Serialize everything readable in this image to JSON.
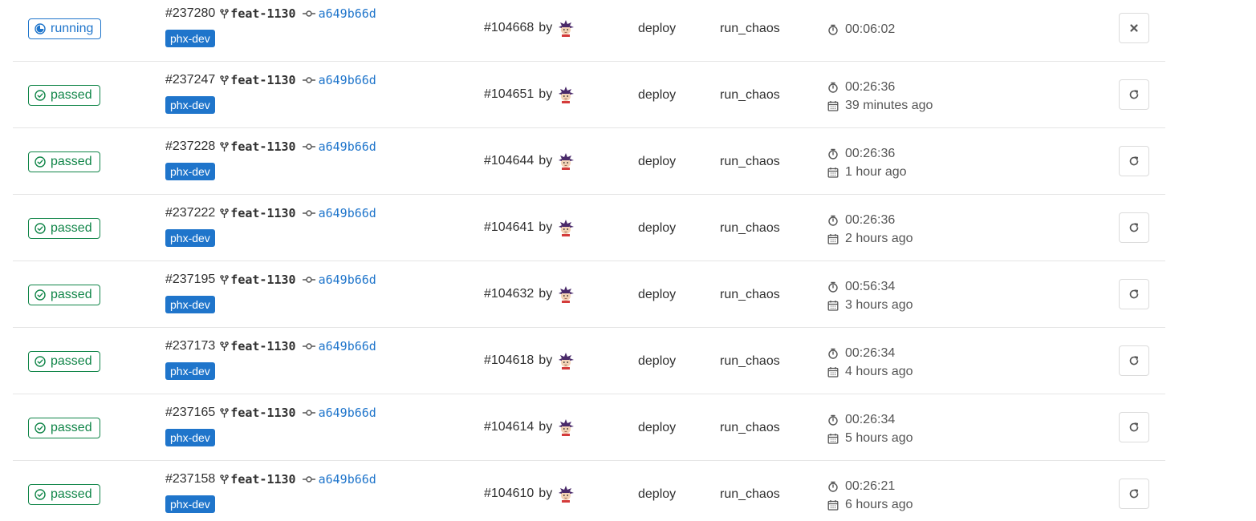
{
  "jobs": [
    {
      "status": "running",
      "job_id": "#237280",
      "branch": "feat-1130",
      "commit": "a649b66d",
      "env": "phx-dev",
      "pipeline": "#104668",
      "by": "by",
      "stage": "deploy",
      "name": "run_chaos",
      "duration": "00:06:02",
      "finished": null,
      "action": "cancel"
    },
    {
      "status": "passed",
      "job_id": "#237247",
      "branch": "feat-1130",
      "commit": "a649b66d",
      "env": "phx-dev",
      "pipeline": "#104651",
      "by": "by",
      "stage": "deploy",
      "name": "run_chaos",
      "duration": "00:26:36",
      "finished": "39 minutes ago",
      "action": "retry"
    },
    {
      "status": "passed",
      "job_id": "#237228",
      "branch": "feat-1130",
      "commit": "a649b66d",
      "env": "phx-dev",
      "pipeline": "#104644",
      "by": "by",
      "stage": "deploy",
      "name": "run_chaos",
      "duration": "00:26:36",
      "finished": "1 hour ago",
      "action": "retry"
    },
    {
      "status": "passed",
      "job_id": "#237222",
      "branch": "feat-1130",
      "commit": "a649b66d",
      "env": "phx-dev",
      "pipeline": "#104641",
      "by": "by",
      "stage": "deploy",
      "name": "run_chaos",
      "duration": "00:26:36",
      "finished": "2 hours ago",
      "action": "retry"
    },
    {
      "status": "passed",
      "job_id": "#237195",
      "branch": "feat-1130",
      "commit": "a649b66d",
      "env": "phx-dev",
      "pipeline": "#104632",
      "by": "by",
      "stage": "deploy",
      "name": "run_chaos",
      "duration": "00:56:34",
      "finished": "3 hours ago",
      "action": "retry"
    },
    {
      "status": "passed",
      "job_id": "#237173",
      "branch": "feat-1130",
      "commit": "a649b66d",
      "env": "phx-dev",
      "pipeline": "#104618",
      "by": "by",
      "stage": "deploy",
      "name": "run_chaos",
      "duration": "00:26:34",
      "finished": "4 hours ago",
      "action": "retry"
    },
    {
      "status": "passed",
      "job_id": "#237165",
      "branch": "feat-1130",
      "commit": "a649b66d",
      "env": "phx-dev",
      "pipeline": "#104614",
      "by": "by",
      "stage": "deploy",
      "name": "run_chaos",
      "duration": "00:26:34",
      "finished": "5 hours ago",
      "action": "retry"
    },
    {
      "status": "passed",
      "job_id": "#237158",
      "branch": "feat-1130",
      "commit": "a649b66d",
      "env": "phx-dev",
      "pipeline": "#104610",
      "by": "by",
      "stage": "deploy",
      "name": "run_chaos",
      "duration": "00:26:21",
      "finished": "6 hours ago",
      "action": "retry"
    }
  ],
  "icons": {
    "passed": "status-success-icon",
    "running": "status-running-icon",
    "branch": "branch-icon",
    "commit": "commit-icon",
    "duration": "timer-icon",
    "finished": "calendar-icon",
    "cancel": "close-icon",
    "retry": "retry-icon",
    "avatar": "user-avatar"
  },
  "colors": {
    "passed": "#108548",
    "running": "#1f75cb",
    "env_label_bg": "#1f75cb",
    "link": "#1f75cb",
    "row_border": "#e5e5e5"
  }
}
